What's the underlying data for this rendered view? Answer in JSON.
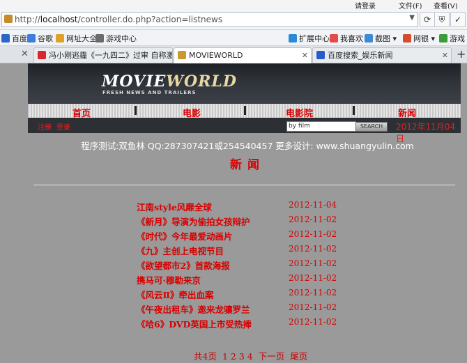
{
  "browser": {
    "menu": {
      "login": "请登录",
      "file": "文件(F)",
      "view": "查看(V)"
    },
    "address": {
      "prefix": "http://",
      "host": "localhost",
      "path": "/controller.do.php?action=listnews"
    },
    "bookmarks": [
      {
        "label": "百度",
        "color": "#2a66c9"
      },
      {
        "label": "谷歌",
        "color": "#3b7de0"
      },
      {
        "label": "网址大全",
        "color": "#e0a12b"
      },
      {
        "label": "游戏中心",
        "color": "#6b6b6b"
      },
      {
        "label": "扩展中心",
        "color": "#2a8ad8"
      },
      {
        "label": "我喜欢",
        "color": "#e24b4b"
      },
      {
        "label": "截图",
        "color": "#3d8bd6"
      },
      {
        "label": "网银",
        "color": "#d44c2a"
      },
      {
        "label": "游戏",
        "color": "#3a9d3a"
      }
    ],
    "tabs": [
      {
        "label": "冯小刚逃霾《一九四二》过审 自称激...",
        "active": false,
        "favicon_color": "#d8262c"
      },
      {
        "label": "MOVIEWORLD",
        "active": true,
        "favicon_color": "#c99a2e"
      },
      {
        "label": "百度搜索_娱乐新闻",
        "active": false,
        "favicon_color": "#2a5cc9"
      }
    ]
  },
  "site": {
    "logo_main": "MOVIE",
    "logo_accent": "WORLD",
    "tagline": "FRESH NEWS AND TRAILERS",
    "nav": [
      "首页",
      "电影",
      "电影院",
      "新闻"
    ],
    "sublinks": [
      "注册",
      "登录"
    ],
    "search_value": "by film",
    "search_button": "SEARCH",
    "date": "2012年11月04日",
    "credits": "程序测试:双鱼林 QQ:287307421或254540457 更多设计: www.shuangyulin.com",
    "page_title": "新闻"
  },
  "news": [
    {
      "title": "江南style风靡全球",
      "date": "2012-11-04"
    },
    {
      "title": "《新月》导演为偷拍女孩辩护",
      "date": "2012-11-02"
    },
    {
      "title": "《时代》今年最爱动画片",
      "date": "2012-11-02"
    },
    {
      "title": "《九》主创上电视节目",
      "date": "2012-11-02"
    },
    {
      "title": "《欲望都市2》首款海报",
      "date": "2012-11-02"
    },
    {
      "title": "携马可·穆勒来京",
      "date": "2012-11-02"
    },
    {
      "title": "《风云Ⅱ》牵出血案",
      "date": "2012-11-02"
    },
    {
      "title": "《午夜出租车》邀来龙骧罗兰",
      "date": "2012-11-02"
    },
    {
      "title": "《哈6》DVD英国上市受热捧",
      "date": "2012-11-02"
    }
  ],
  "pager": {
    "total": "共4页",
    "pages": [
      "1",
      "2",
      "3",
      "4"
    ],
    "next": "下一页",
    "last": "尾页"
  }
}
